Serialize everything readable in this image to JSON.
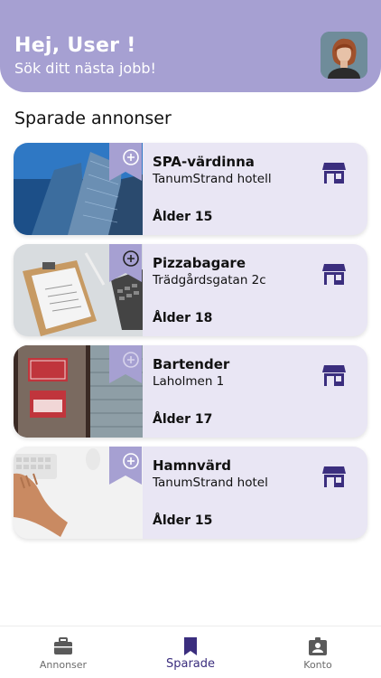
{
  "header": {
    "greeting": "Hej, User !",
    "subtitle": "Sök ditt nästa jobb!",
    "background_color": "#a6a0d2"
  },
  "section_title": "Sparade annonser",
  "listings": [
    {
      "title": "SPA-värdinna",
      "location": "TanumStrand hotell",
      "age": "Ålder 15",
      "image": "office-building-photo"
    },
    {
      "title": "Pizzabagare",
      "location": "Trädgårdsgatan 2c",
      "age": "Ålder 18",
      "image": "clipboard-desk-photo"
    },
    {
      "title": "Bartender",
      "location": "Laholmen 1",
      "age": "Ålder 17",
      "image": "we-are-hiring-sign-photo"
    },
    {
      "title": "Hamnvärd",
      "location": "TanumStrand hotel",
      "age": "Ålder 15",
      "image": "hand-keyboard-desk-photo"
    }
  ],
  "card_color": "#e9e6f4",
  "accent_color": "#3b2e7e",
  "nav": {
    "items": [
      {
        "label": "Annonser",
        "icon": "briefcase-icon",
        "active": false
      },
      {
        "label": "Sparade",
        "icon": "bookmark-icon",
        "active": true
      },
      {
        "label": "Konto",
        "icon": "id-badge-icon",
        "active": false
      }
    ]
  }
}
